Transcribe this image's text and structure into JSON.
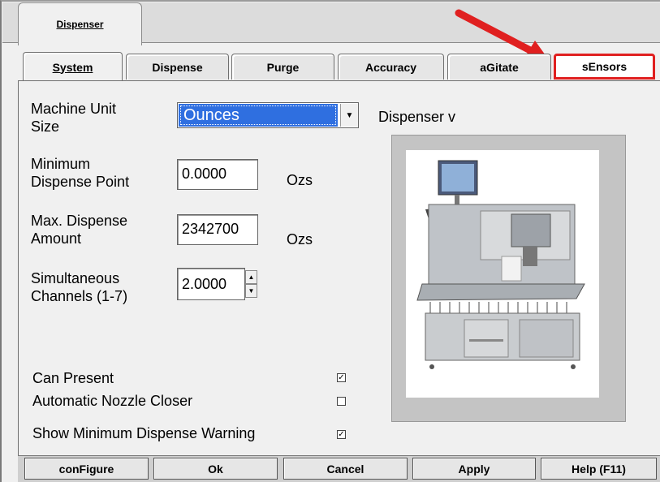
{
  "top_tab": {
    "label": "Dispenser"
  },
  "tabs": [
    {
      "label": "System"
    },
    {
      "label": "Dispense"
    },
    {
      "label": "Purge"
    },
    {
      "label": "Accuracy"
    },
    {
      "label": "aGitate"
    },
    {
      "label": "sEnsors"
    }
  ],
  "fields": {
    "machine_unit_size": {
      "label_line1": "Machine Unit",
      "label_line2": "Size",
      "value": "Ounces"
    },
    "minimum_dispense_point": {
      "label_line1": "Minimum",
      "label_line2": "Dispense Point",
      "value": "0.0000",
      "unit": "Ozs"
    },
    "max_dispense_amount": {
      "label_line1": "Max. Dispense",
      "label_line2": "Amount",
      "value": "2342700",
      "unit": "Ozs"
    },
    "simultaneous_channels": {
      "label_line1": "Simultaneous",
      "label_line2": "Channels (1-7)",
      "value": "2.0000"
    }
  },
  "dispenser_label": "Dispenser v",
  "checkboxes": [
    {
      "label": "Can Present",
      "checked": true
    },
    {
      "label": "Automatic Nozzle Closer",
      "checked": false
    },
    {
      "label": "Show Minimum Dispense Warning",
      "checked": true
    }
  ],
  "buttons": {
    "configure": "conFigure",
    "ok": "Ok",
    "cancel": "Cancel",
    "apply": "Apply",
    "help": "Help (F11)"
  },
  "colors": {
    "selection": "#2f6fe0",
    "annotation": "#e02020"
  },
  "icons": {
    "arrow": "annotation-arrow-icon",
    "dropdown": "chevron-down-icon"
  }
}
